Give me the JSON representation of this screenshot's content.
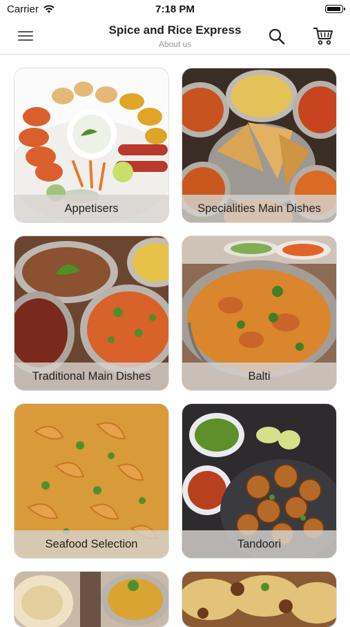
{
  "status_bar": {
    "carrier": "Carrier",
    "time": "7:18 PM",
    "battery_level": 0.9
  },
  "nav": {
    "title": "Spice and Rice Express",
    "subtitle": "About us",
    "menu_icon": "hamburger-menu-icon",
    "search_icon": "search-icon",
    "cart_icon": "shopping-cart-icon"
  },
  "categories": [
    {
      "label": "Appetisers"
    },
    {
      "label": "Specialities Main Dishes"
    },
    {
      "label": "Traditional Main Dishes"
    },
    {
      "label": "Balti"
    },
    {
      "label": "Seafood Selection"
    },
    {
      "label": "Tandoori"
    },
    {
      "label": ""
    },
    {
      "label": ""
    }
  ],
  "colors": {
    "label_overlay": "#d7d2cd",
    "divider": "#e2e2e2",
    "curry_orange": "#d9862c",
    "herb_green": "#4f8f2a"
  }
}
